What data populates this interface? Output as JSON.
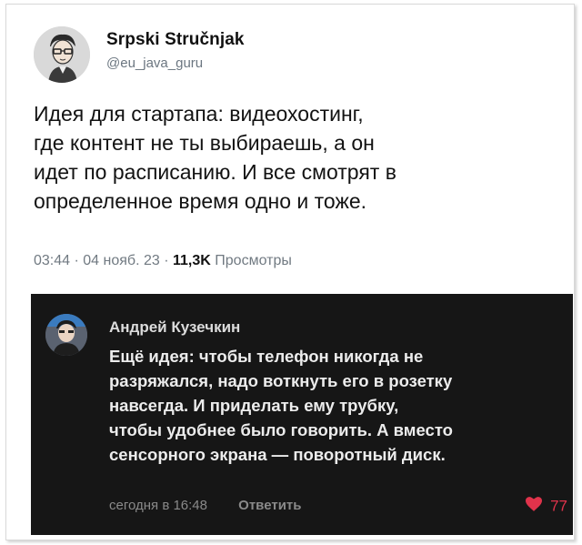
{
  "tweet": {
    "author_name": "Srpski Stručnjak",
    "author_handle": "@eu_java_guru",
    "text_lines": [
      "Идея для стартапа: видеохостинг,",
      "где контент не ты выбираешь, а он",
      "идет по расписанию. И все смотрят в",
      "определенное время одно и тоже."
    ],
    "time": "03:44",
    "date": "04 нояб. 23",
    "views_count": "11,3K",
    "views_label": "Просмотры",
    "separator": "·"
  },
  "comment": {
    "author_name": "Андрей Кузечкин",
    "text_lines": [
      "Ещё идея: чтобы телефон никогда не",
      "разряжался, надо воткнуть его в розетку",
      "навсегда. И приделать ему трубку,",
      "чтобы удобнее было говорить. А вместо",
      "сенсорного экрана — поворотный диск."
    ],
    "time": "сегодня в 16:48",
    "reply_label": "Ответить",
    "like_count": "77",
    "like_color": "#e0334b"
  },
  "icons": {
    "like": "heart-icon"
  }
}
